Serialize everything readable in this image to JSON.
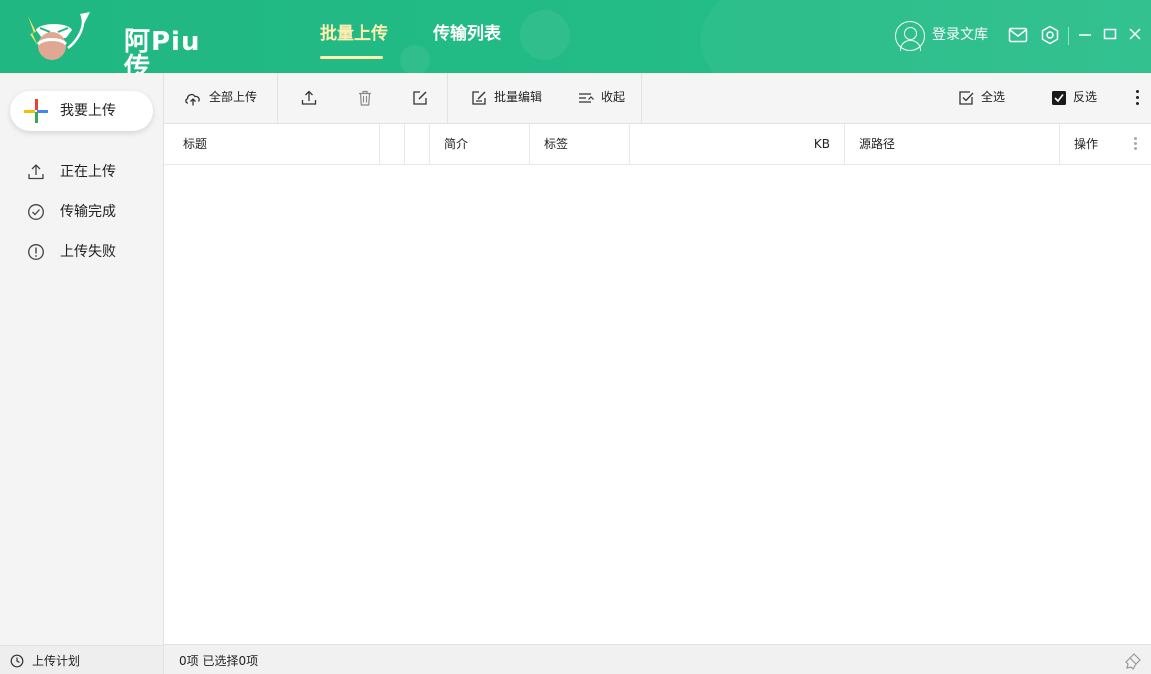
{
  "app": {
    "logo_text": "阿Piu传",
    "brand_color": "#22b883",
    "accent_color": "#ffeeb0"
  },
  "header": {
    "tabs": [
      {
        "label": "批量上传",
        "active": true
      },
      {
        "label": "传输列表",
        "active": false
      }
    ],
    "login_label": "登录文库",
    "icons": [
      "user-icon",
      "mail-icon",
      "settings-icon",
      "minimize-icon",
      "maximize-icon",
      "close-icon"
    ]
  },
  "sidebar": {
    "upload_button": "我要上传",
    "items": [
      {
        "label": "正在上传",
        "icon": "upload-icon"
      },
      {
        "label": "传输完成",
        "icon": "check-circle-icon"
      },
      {
        "label": "上传失败",
        "icon": "alert-circle-icon"
      }
    ],
    "footer_label": "上传计划"
  },
  "toolbar": {
    "upload_all": "全部上传",
    "batch_edit": "批量编辑",
    "collapse": "收起",
    "select_all": "全选",
    "invert_select": "反选",
    "icons": [
      "upload-icon",
      "trash-icon",
      "edit-icon"
    ]
  },
  "table": {
    "columns": [
      "标题",
      "",
      "",
      "简介",
      "标签",
      "KB",
      "源路径",
      "操作"
    ],
    "rows": []
  },
  "status": {
    "summary": "0项 已选择0项"
  }
}
